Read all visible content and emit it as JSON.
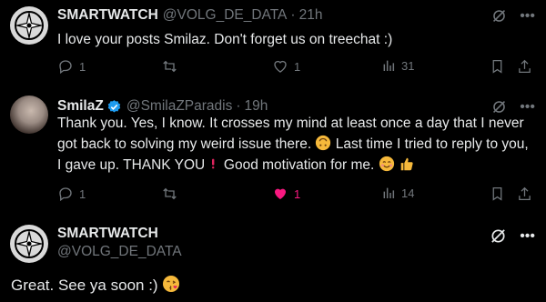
{
  "tweets": [
    {
      "name": "SMARTWATCH",
      "handle": "@VOLG_DE_DATA",
      "time": "21h",
      "text": "I love your posts Smilaz. Don't forget us on treechat :)",
      "replies": "1",
      "reposts": "",
      "likes": "1",
      "views": "31"
    },
    {
      "name": "SmilaZ",
      "handle": "@SmilaZParadis",
      "time": "19h",
      "text_parts": [
        "Thank you. Yes, I know. It crosses my mind at least once a day that I never got back to solving my weird issue there.",
        "Last time I tried to reply to you, I gave up. THANK YOU",
        "Good motivation for me."
      ],
      "replies": "1",
      "reposts": "",
      "likes": "1",
      "views": "14"
    },
    {
      "name": "SMARTWATCH",
      "handle": "@VOLG_DE_DATA",
      "text": "Great. See ya soon :)"
    }
  ],
  "colors": {
    "background": "#000000",
    "text": "#e7e9ea",
    "muted": "#71767b",
    "verified": "#1d9bf0",
    "like_active": "#f91880"
  },
  "meta_separator": "·"
}
